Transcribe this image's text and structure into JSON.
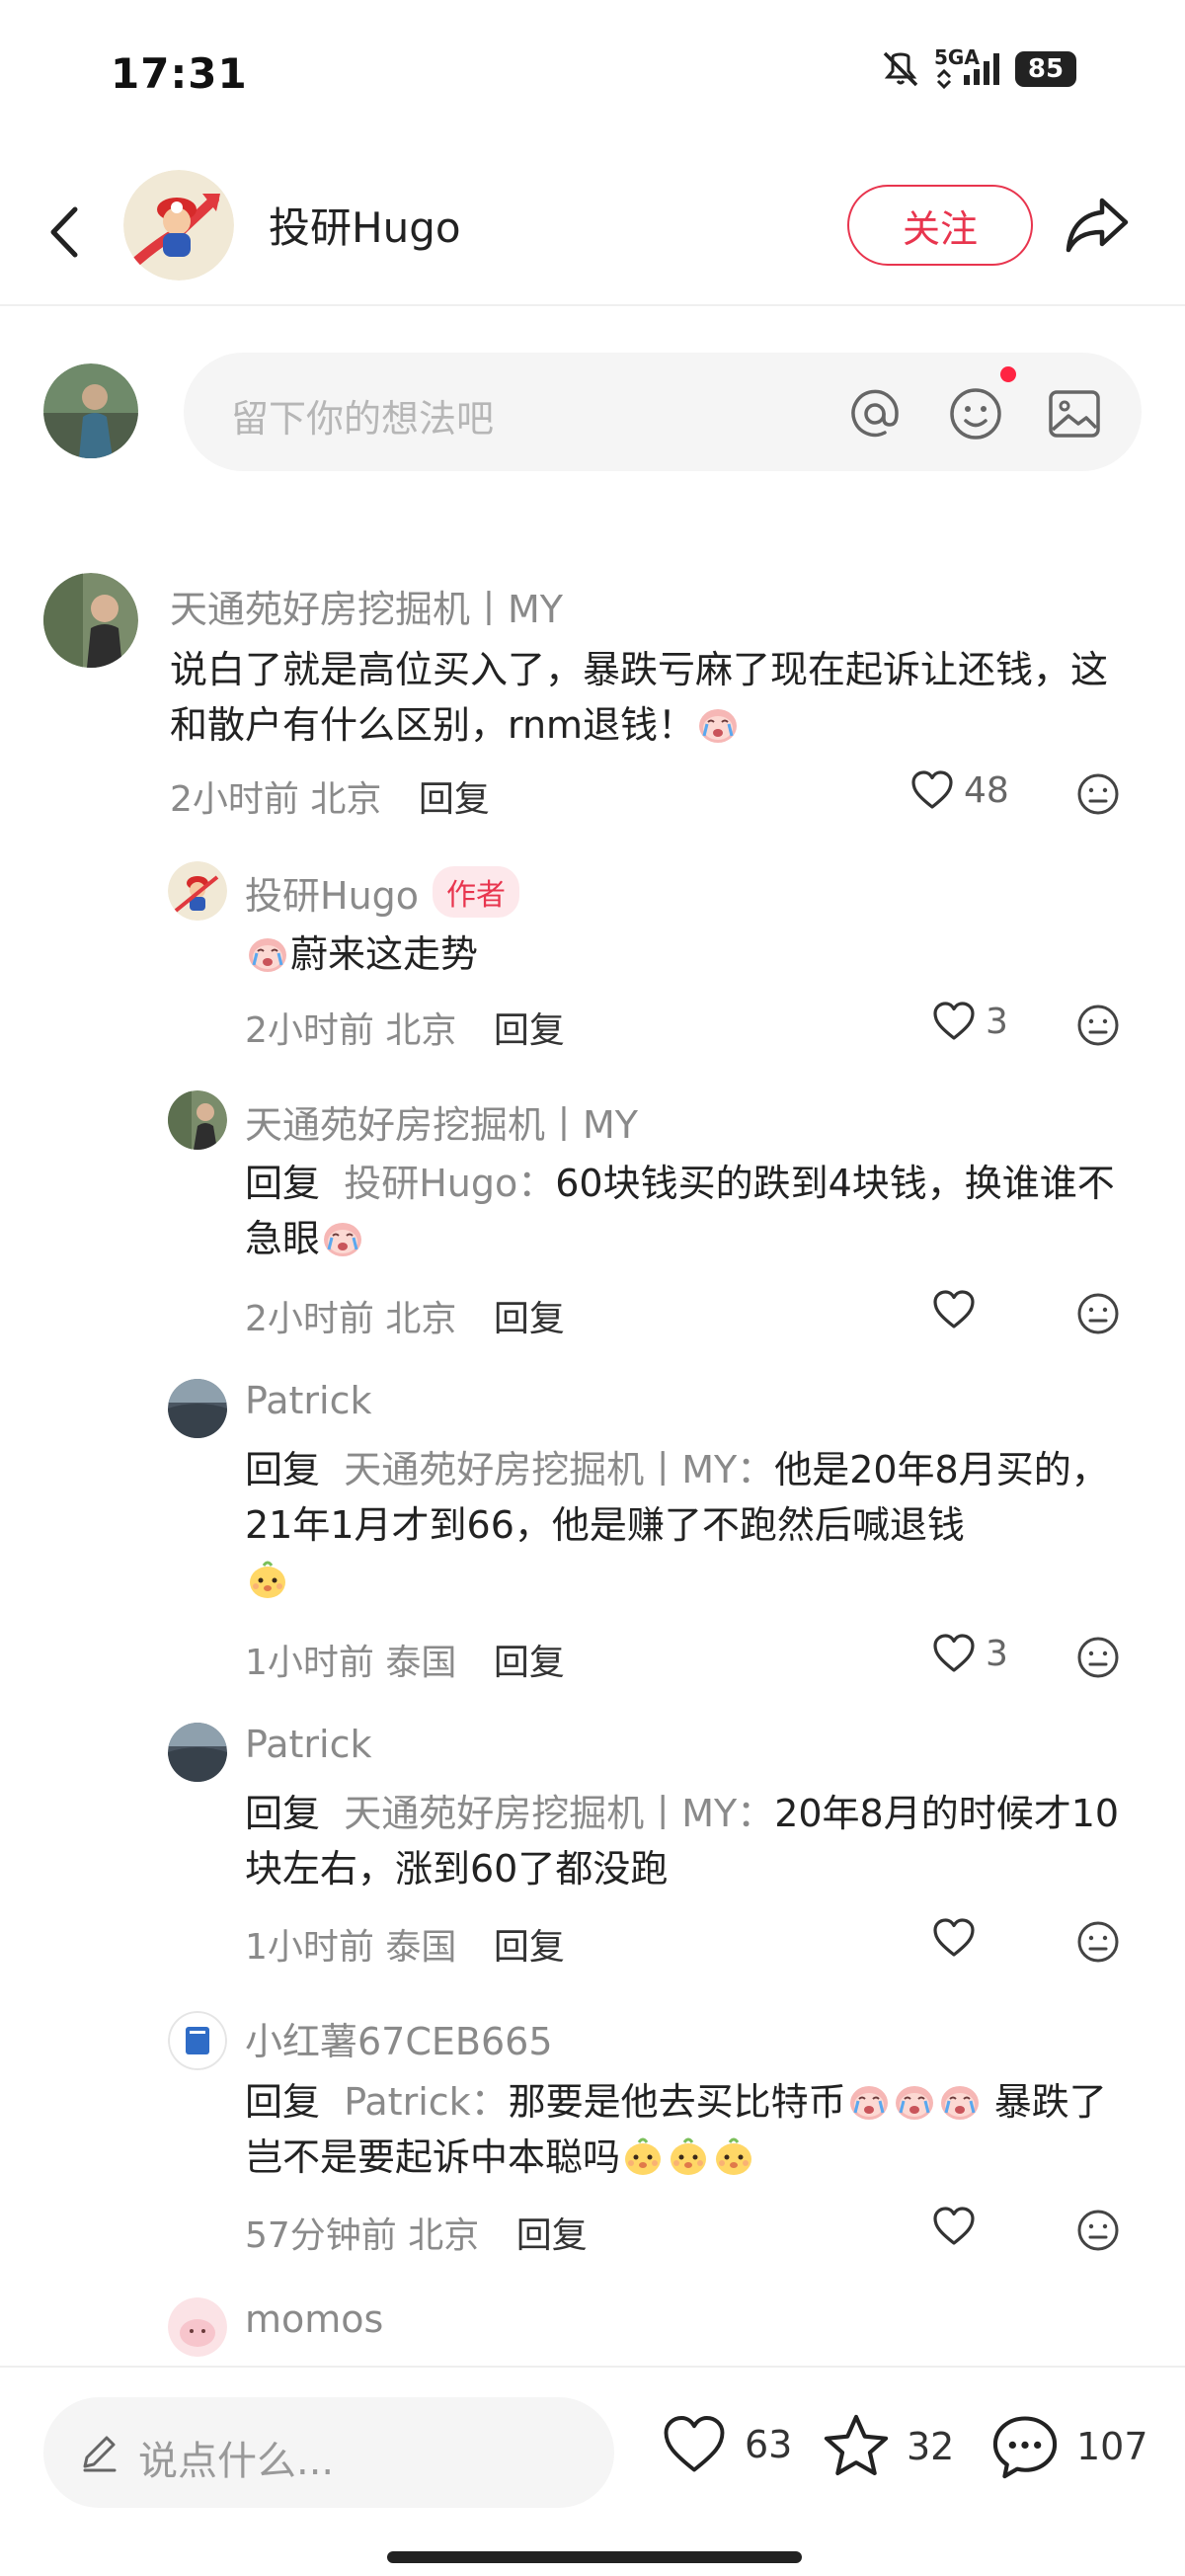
{
  "status_bar": {
    "time": "17:31",
    "network": "5GA",
    "battery": "85"
  },
  "header": {
    "author_name": "投研Hugo",
    "follow_label": "关注"
  },
  "comment_input": {
    "placeholder": "留下你的想法吧"
  },
  "comments": [
    {
      "name": "天通苑好房挖掘机丨MY",
      "text": "说白了就是高位买入了，暴跌亏麻了现在起诉让还钱，这和散户有什么区别，rnm退钱！",
      "time": "2小时前",
      "location": "北京",
      "reply_label": "回复",
      "likes": "48"
    },
    {
      "name": "投研Hugo",
      "author_tag": "作者",
      "text": "蔚来这走势",
      "time": "2小时前",
      "location": "北京",
      "reply_label": "回复",
      "likes": "3"
    },
    {
      "name": "天通苑好房挖掘机丨MY",
      "reply_prefix": "回复",
      "reply_to": "投研Hugo：",
      "text": "60块钱买的跌到4块钱，换谁谁不急眼",
      "time": "2小时前",
      "location": "北京",
      "reply_label": "回复",
      "likes": ""
    },
    {
      "name": "Patrick",
      "reply_prefix": "回复",
      "reply_to": "天通苑好房挖掘机丨MY：",
      "text": "他是20年8月买的，21年1月才到66，他是赚了不跑然后喊退钱",
      "time": "1小时前",
      "location": "泰国",
      "reply_label": "回复",
      "likes": "3"
    },
    {
      "name": "Patrick",
      "reply_prefix": "回复",
      "reply_to": "天通苑好房挖掘机丨MY：",
      "text": "20年8月的时候才10块左右，涨到60了都没跑",
      "time": "1小时前",
      "location": "泰国",
      "reply_label": "回复",
      "likes": ""
    },
    {
      "name": "小红薯67CEB665",
      "reply_prefix": "回复",
      "reply_to": "Patrick：",
      "text_a": "那要是他去买比特币",
      "text_b": " 暴跌了岂不是要起诉中本聪吗",
      "time": "57分钟前",
      "location": "北京",
      "reply_label": "回复",
      "likes": ""
    },
    {
      "name": "momos"
    }
  ],
  "bottom_bar": {
    "input_placeholder": "说点什么...",
    "like_count": "63",
    "collect_count": "32",
    "comment_count": "107"
  },
  "colors": {
    "accent": "#e8354e",
    "muted_text": "#8a8a8a",
    "input_bg": "#f5f5f5"
  }
}
